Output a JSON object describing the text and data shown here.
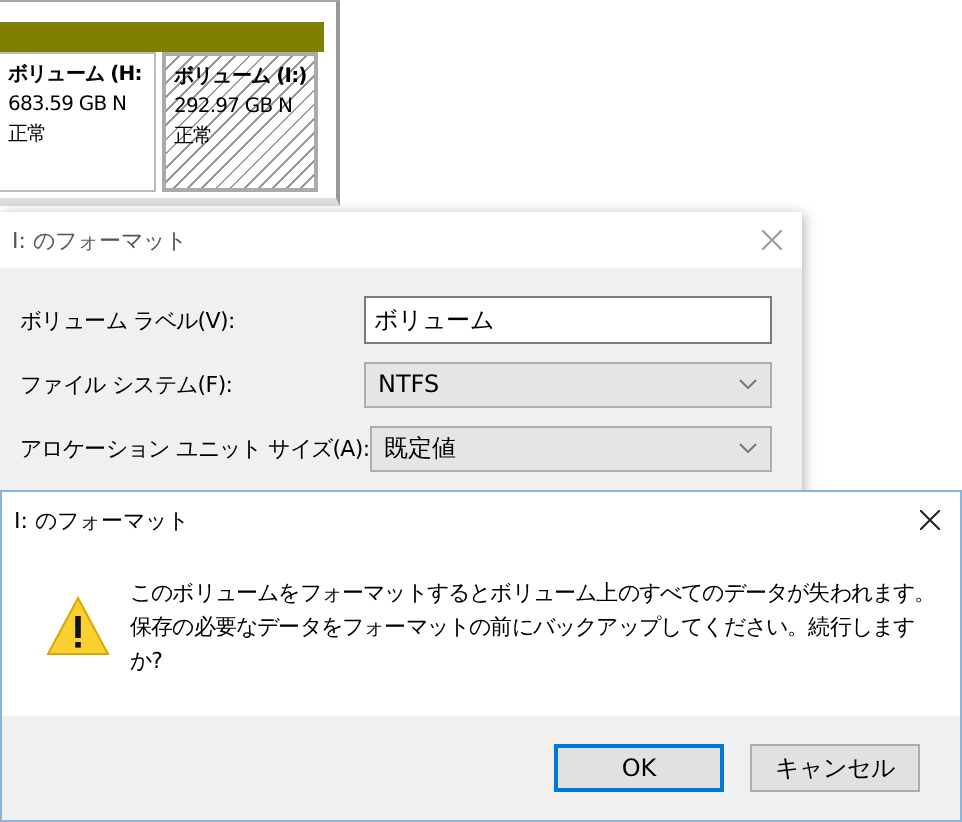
{
  "disk_panel": {
    "partitions": [
      {
        "label": "ボリューム (H:",
        "size": "683.59 GB N",
        "status": "正常",
        "selected": false
      },
      {
        "label": "ボリューム (I:)",
        "size": "292.97 GB N",
        "status": "正常",
        "selected": true
      }
    ]
  },
  "format_dialog": {
    "title": "I: のフォーマット",
    "fields": [
      {
        "label": "ボリューム ラベル(V):",
        "kind": "text",
        "value": "ボリューム"
      },
      {
        "label": "ファイル システム(F):",
        "kind": "select",
        "value": "NTFS"
      },
      {
        "label": "アロケーション ユニット サイズ(A):",
        "kind": "select",
        "value": "既定値"
      }
    ]
  },
  "message_box": {
    "title": "I: のフォーマット",
    "message": "このボリュームをフォーマットするとボリューム上のすべてのデータが失われます。保存の必要なデータをフォーマットの前にバックアップしてください。続行しますか?",
    "buttons": [
      {
        "label": "OK",
        "default": true
      },
      {
        "label": "キャンセル",
        "default": false
      }
    ]
  }
}
